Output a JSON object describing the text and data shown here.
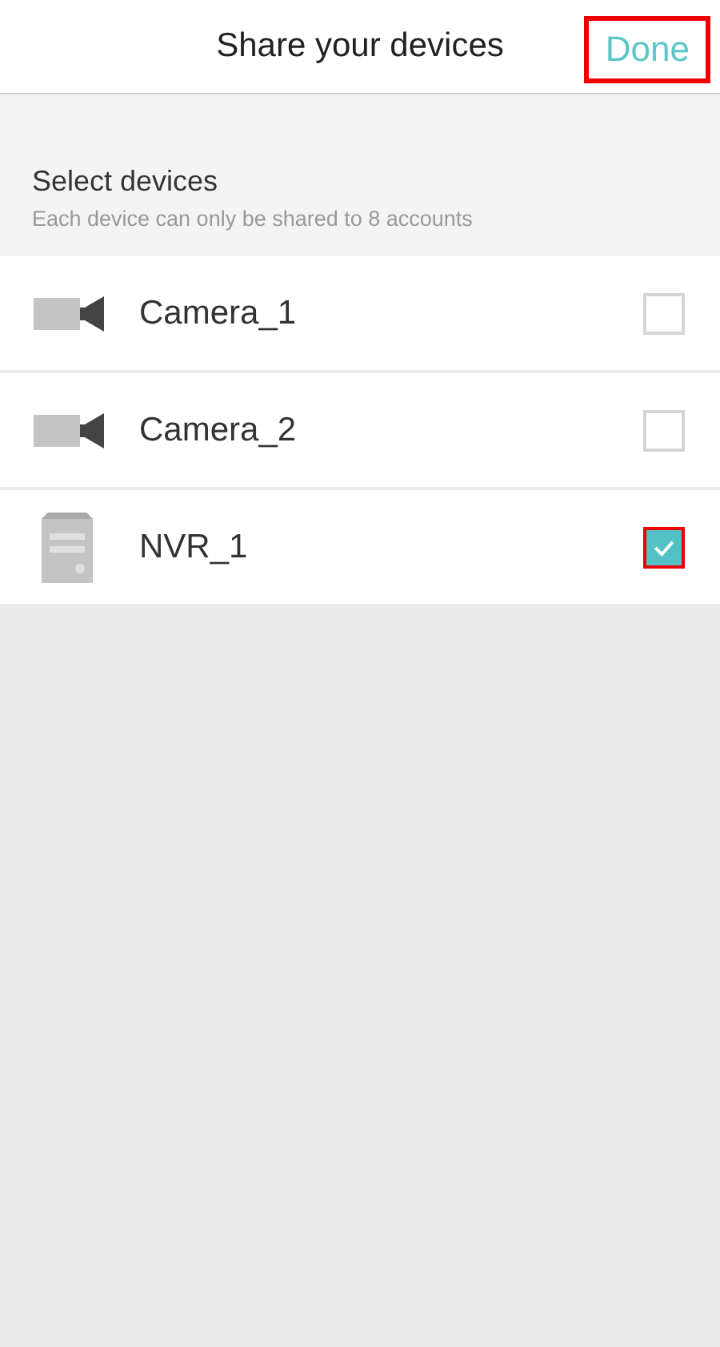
{
  "header": {
    "title": "Share your devices",
    "done": {
      "label": "Done",
      "highlighted": true
    }
  },
  "section": {
    "title": "Select devices",
    "subtitle": "Each device can only be shared to 8 accounts"
  },
  "devices": [
    {
      "kind": "camera",
      "name": "Camera_1",
      "checked": false,
      "highlighted": false
    },
    {
      "kind": "camera",
      "name": "Camera_2",
      "checked": false,
      "highlighted": false
    },
    {
      "kind": "nvr",
      "name": "NVR_1",
      "checked": true,
      "highlighted": true
    }
  ]
}
